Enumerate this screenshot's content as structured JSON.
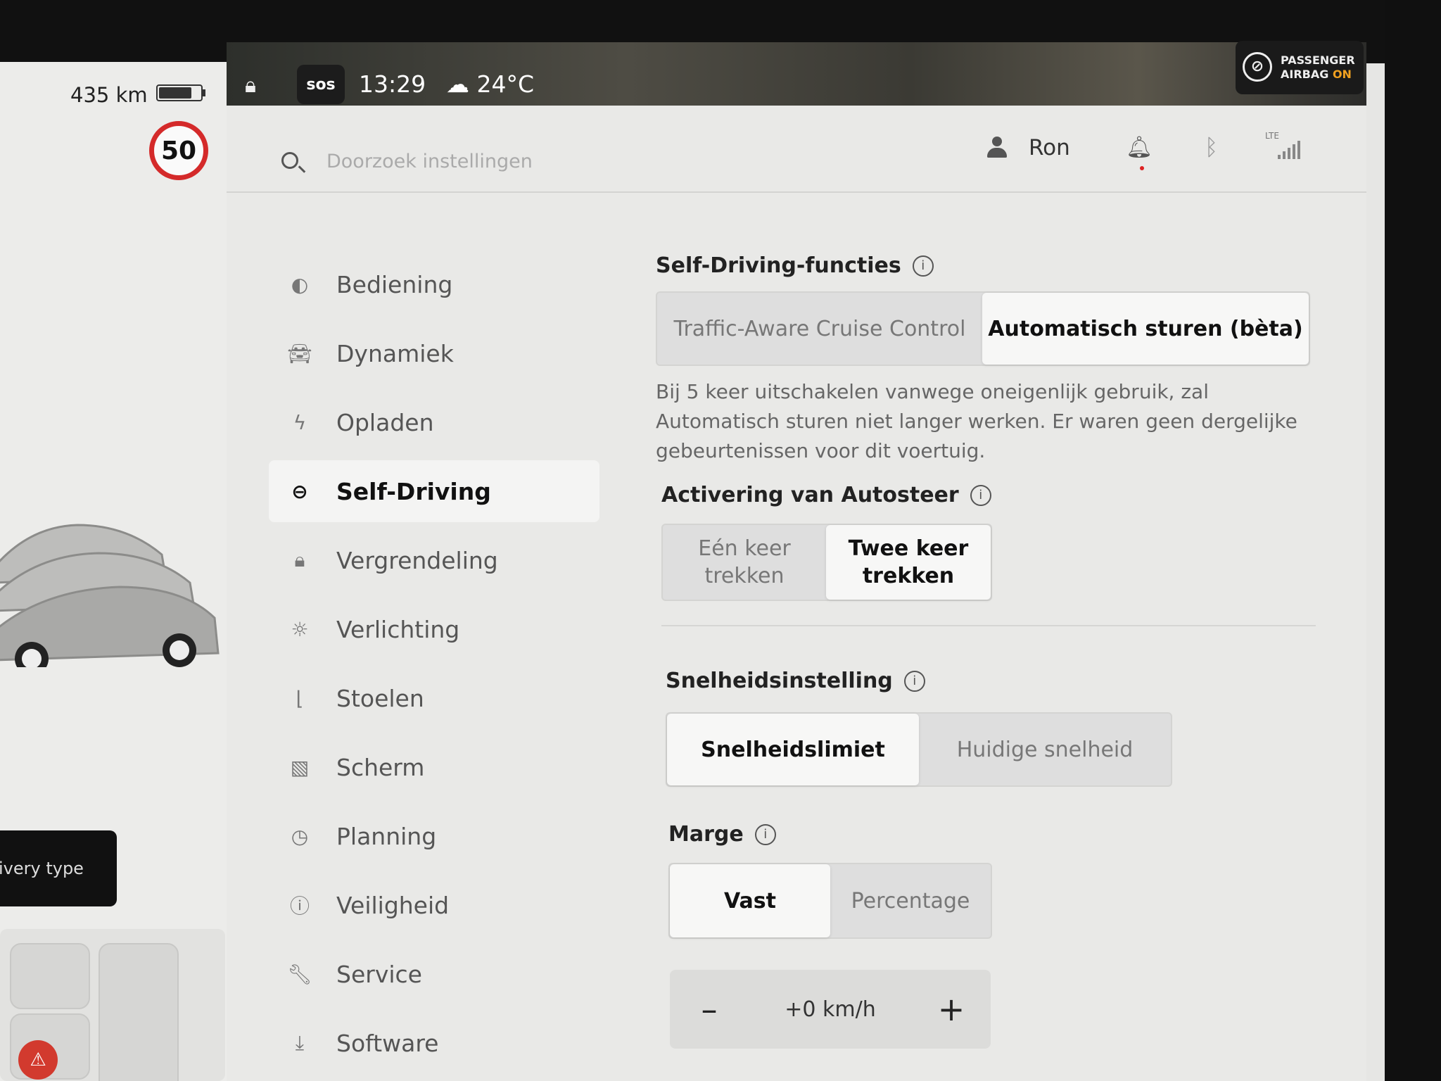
{
  "car": {
    "range": "435 km",
    "battery_level": 0.8,
    "speed_limit": "50",
    "delivery_label": "ivery type"
  },
  "status": {
    "sos": "sos",
    "time": "13:29",
    "temperature": "24°C",
    "airbag_line1": "PASSENGER",
    "airbag_line2": "AIRBAG",
    "airbag_state": "ON"
  },
  "header": {
    "search_placeholder": "Doorzoek instellingen",
    "user_name": "Ron",
    "network": "LTE"
  },
  "nav": {
    "items": [
      {
        "label": "Bediening",
        "icon": "toggle-icon"
      },
      {
        "label": "Dynamiek",
        "icon": "car-icon"
      },
      {
        "label": "Opladen",
        "icon": "bolt-icon"
      },
      {
        "label": "Self-Driving",
        "icon": "steering-wheel-icon"
      },
      {
        "label": "Vergrendeling",
        "icon": "lock-icon"
      },
      {
        "label": "Verlichting",
        "icon": "sun-icon"
      },
      {
        "label": "Stoelen",
        "icon": "seat-icon"
      },
      {
        "label": "Scherm",
        "icon": "display-icon"
      },
      {
        "label": "Planning",
        "icon": "clock-icon"
      },
      {
        "label": "Veiligheid",
        "icon": "alert-icon"
      },
      {
        "label": "Service",
        "icon": "wrench-icon"
      },
      {
        "label": "Software",
        "icon": "download-icon"
      }
    ],
    "active": "Self-Driving"
  },
  "content": {
    "self_driving_title": "Self-Driving-functies",
    "self_driving_options": [
      "Traffic-Aware Cruise Control",
      "Automatisch sturen (bèta)"
    ],
    "self_driving_selected": "Automatisch sturen (bèta)",
    "warning_text": "Bij 5 keer uitschakelen vanwege oneigenlijk gebruik, zal Automatisch sturen niet langer werken. Er waren geen dergelijke gebeurtenissen voor dit voertuig.",
    "autosteer_title": "Activering van Autosteer",
    "autosteer_options": [
      "Eén keer trekken",
      "Twee keer trekken"
    ],
    "autosteer_selected": "Twee keer trekken",
    "speed_title": "Snelheidsinstelling",
    "speed_options": [
      "Snelheidslimiet",
      "Huidige snelheid"
    ],
    "speed_selected": "Snelheidslimiet",
    "margin_title": "Marge",
    "margin_options": [
      "Vast",
      "Percentage"
    ],
    "margin_selected": "Vast",
    "offset_value": "+0 km/h",
    "minus": "–",
    "plus": "+"
  }
}
